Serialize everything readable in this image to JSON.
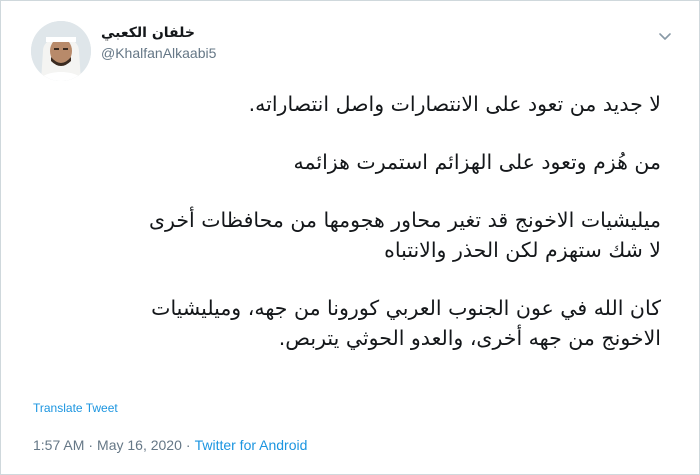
{
  "author": {
    "display_name": "خلفان الكعبي",
    "handle": "@KhalfanAlkaabi5"
  },
  "icons": {
    "menu": "chevron-down-icon",
    "avatar": "user-avatar"
  },
  "tweet": {
    "paragraphs": [
      "لا جديد من تعود على الانتصارات واصل انتصاراته.",
      "من هُزم وتعود على الهزائم استمرت هزائمه",
      "ميليشيات الاخونج قد تغير محاور هجومها من محافظات أخرى\nلا شك ستهزم   لكن الحذر والانتباه",
      "كان الله في عون الجنوب العربي كورونا من جهه، وميليشيات\nالاخونج من جهه أخرى،  والعدو الحوثي يتربص."
    ]
  },
  "translate_label": "Translate Tweet",
  "meta": {
    "time": "1:57 AM",
    "separator1": "·",
    "date": "May 16, 2020",
    "separator2": "·",
    "source": "Twitter for Android"
  },
  "colors": {
    "link": "#1b95e0",
    "muted": "#657786",
    "text": "#14171a"
  }
}
